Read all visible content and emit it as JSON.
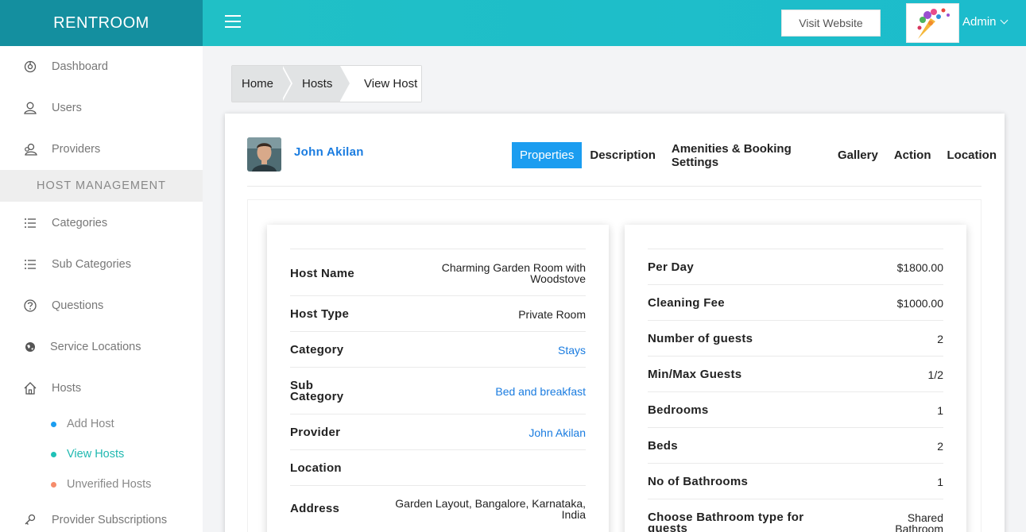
{
  "brand": "RENTROOM",
  "topbar": {
    "visit_label": "Visit Website",
    "admin_label": "Admin"
  },
  "sidebar": {
    "items": [
      {
        "label": "Dashboard",
        "icon": "dashboard-icon"
      },
      {
        "label": "Users",
        "icon": "user-icon"
      },
      {
        "label": "Providers",
        "icon": "providers-icon"
      }
    ],
    "section": "HOST MANAGEMENT",
    "items2": [
      {
        "label": "Categories",
        "icon": "list-icon"
      },
      {
        "label": "Sub Categories",
        "icon": "list-icon"
      },
      {
        "label": "Questions",
        "icon": "question-icon"
      },
      {
        "label": "Service Locations",
        "icon": "globe-icon"
      },
      {
        "label": "Hosts",
        "icon": "home-icon"
      }
    ],
    "sub_items": [
      {
        "label": "Add Host",
        "dot_color": "#1b9df0",
        "active": false
      },
      {
        "label": "View Hosts",
        "dot_color": "#1fc1b7",
        "active": true
      },
      {
        "label": "Unverified Hosts",
        "dot_color": "#f58c6b",
        "active": false
      }
    ],
    "last_item": {
      "label": "Provider Subscriptions",
      "icon": "key-icon"
    }
  },
  "breadcrumb": [
    "Home",
    "Hosts",
    "View Host"
  ],
  "host": {
    "name": "John Akilan",
    "tabs": [
      "Properties",
      "Description",
      "Amenities & Booking Settings",
      "Gallery",
      "Action",
      "Location"
    ],
    "active_tab": "Properties"
  },
  "left_details": [
    {
      "key": "Host Name",
      "value": "Charming Garden Room with Woodstove",
      "link": false
    },
    {
      "key": "Host Type",
      "value": "Private Room",
      "link": false
    },
    {
      "key": "Category",
      "value": "Stays",
      "link": true
    },
    {
      "key": "Sub Category",
      "value": "Bed and breakfast",
      "link": true
    },
    {
      "key": "Provider",
      "value": "John Akilan",
      "link": true
    },
    {
      "key": "Location",
      "value": "",
      "link": false
    },
    {
      "key": "Address",
      "value": "Garden Layout, Bangalore, Karnataka, India",
      "link": false
    }
  ],
  "right_details": [
    {
      "key": "Per Day",
      "value": "$1800.00"
    },
    {
      "key": "Cleaning Fee",
      "value": "$1000.00"
    },
    {
      "key": "Number of guests",
      "value": "2"
    },
    {
      "key": "Min/Max Guests",
      "value": "1/2"
    },
    {
      "key": "Bedrooms",
      "value": "1"
    },
    {
      "key": "Beds",
      "value": "2"
    },
    {
      "key": "No of Bathrooms",
      "value": "1"
    },
    {
      "key": "Choose Bathroom type for guests",
      "value": "Shared Bathroom"
    }
  ]
}
